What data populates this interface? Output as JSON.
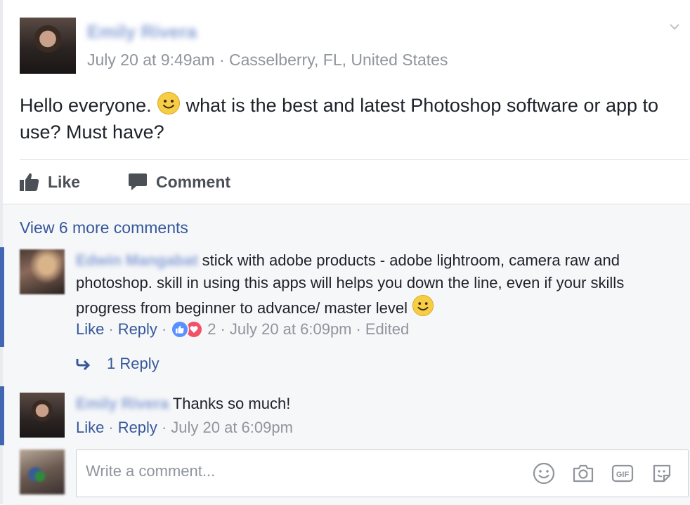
{
  "post": {
    "author": "Emily Rivera",
    "meta": "July 20 at 9:49am · Casselberry, FL, United States",
    "text_part1": "Hello everyone. ",
    "text_part2": " what is the best and latest Photoshop software or app to use? Must have?"
  },
  "actions": {
    "like_label": "Like",
    "comment_label": "Comment"
  },
  "comments": {
    "view_more": "View 6 more comments",
    "items": [
      {
        "author": "Edwin Mangabat",
        "text": " stick with adobe products - adobe lightroom, camera raw and photoshop. skill in using this apps will helps you down the line, even if your skills progress from beginner to advance/ master level ",
        "like_label": "Like",
        "reply_label": "Reply",
        "reaction_count": "2",
        "timestamp": "July 20 at 6:09pm",
        "edited": "Edited",
        "replies_label": "1 Reply"
      },
      {
        "author": "Emily Rivera",
        "text": " Thanks so much!",
        "like_label": "Like",
        "reply_label": "Reply",
        "timestamp": "July 20 at 6:09pm"
      }
    ]
  },
  "composer": {
    "placeholder": "Write a comment..."
  },
  "icons": {
    "chevron": "chevron-down-icon",
    "like": "thumbs-up-icon",
    "comment": "speech-bubble-icon",
    "reply_arrow": "reply-arrow-icon",
    "emoji": "smiley-icon",
    "camera": "camera-icon",
    "gif": "gif-icon",
    "sticker": "sticker-icon"
  },
  "colors": {
    "link": "#365899",
    "muted": "#90949c",
    "thread_bar": "#4267b2",
    "like_reaction": "#5890ff",
    "love_reaction": "#f25268"
  }
}
